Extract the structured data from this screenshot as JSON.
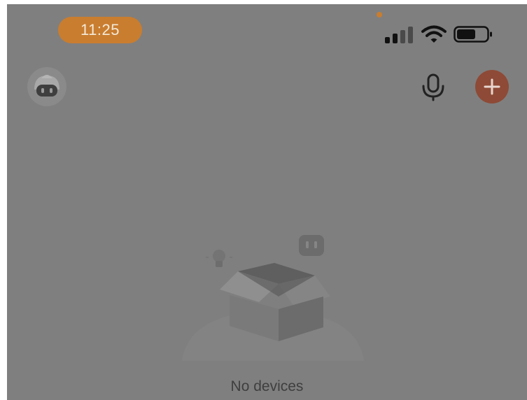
{
  "status_bar": {
    "time": "11:25",
    "cellular_icon": "signal-bars-icon",
    "wifi_icon": "wifi-icon",
    "battery_icon": "battery-icon",
    "privacy_dot_color": "#c97d2f"
  },
  "top_bar": {
    "avatar_icon": "robot-avatar-icon",
    "mic_icon": "microphone-icon",
    "add_icon": "plus-icon",
    "accent_color": "#8e4a36"
  },
  "empty_state": {
    "illustration": "empty-box-icon",
    "message": "No devices"
  }
}
